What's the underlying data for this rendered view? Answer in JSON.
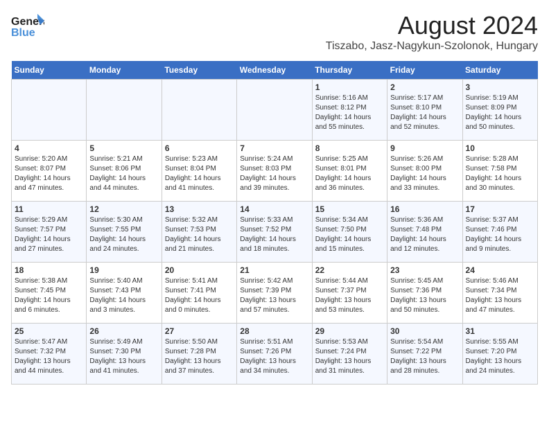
{
  "header": {
    "logo_general": "General",
    "logo_blue": "Blue",
    "title": "August 2024",
    "subtitle": "Tiszabo, Jasz-Nagykun-Szolonok, Hungary"
  },
  "days_of_week": [
    "Sunday",
    "Monday",
    "Tuesday",
    "Wednesday",
    "Thursday",
    "Friday",
    "Saturday"
  ],
  "weeks": [
    [
      {
        "day": "",
        "info": ""
      },
      {
        "day": "",
        "info": ""
      },
      {
        "day": "",
        "info": ""
      },
      {
        "day": "",
        "info": ""
      },
      {
        "day": "1",
        "info": "Sunrise: 5:16 AM\nSunset: 8:12 PM\nDaylight: 14 hours\nand 55 minutes."
      },
      {
        "day": "2",
        "info": "Sunrise: 5:17 AM\nSunset: 8:10 PM\nDaylight: 14 hours\nand 52 minutes."
      },
      {
        "day": "3",
        "info": "Sunrise: 5:19 AM\nSunset: 8:09 PM\nDaylight: 14 hours\nand 50 minutes."
      }
    ],
    [
      {
        "day": "4",
        "info": "Sunrise: 5:20 AM\nSunset: 8:07 PM\nDaylight: 14 hours\nand 47 minutes."
      },
      {
        "day": "5",
        "info": "Sunrise: 5:21 AM\nSunset: 8:06 PM\nDaylight: 14 hours\nand 44 minutes."
      },
      {
        "day": "6",
        "info": "Sunrise: 5:23 AM\nSunset: 8:04 PM\nDaylight: 14 hours\nand 41 minutes."
      },
      {
        "day": "7",
        "info": "Sunrise: 5:24 AM\nSunset: 8:03 PM\nDaylight: 14 hours\nand 39 minutes."
      },
      {
        "day": "8",
        "info": "Sunrise: 5:25 AM\nSunset: 8:01 PM\nDaylight: 14 hours\nand 36 minutes."
      },
      {
        "day": "9",
        "info": "Sunrise: 5:26 AM\nSunset: 8:00 PM\nDaylight: 14 hours\nand 33 minutes."
      },
      {
        "day": "10",
        "info": "Sunrise: 5:28 AM\nSunset: 7:58 PM\nDaylight: 14 hours\nand 30 minutes."
      }
    ],
    [
      {
        "day": "11",
        "info": "Sunrise: 5:29 AM\nSunset: 7:57 PM\nDaylight: 14 hours\nand 27 minutes."
      },
      {
        "day": "12",
        "info": "Sunrise: 5:30 AM\nSunset: 7:55 PM\nDaylight: 14 hours\nand 24 minutes."
      },
      {
        "day": "13",
        "info": "Sunrise: 5:32 AM\nSunset: 7:53 PM\nDaylight: 14 hours\nand 21 minutes."
      },
      {
        "day": "14",
        "info": "Sunrise: 5:33 AM\nSunset: 7:52 PM\nDaylight: 14 hours\nand 18 minutes."
      },
      {
        "day": "15",
        "info": "Sunrise: 5:34 AM\nSunset: 7:50 PM\nDaylight: 14 hours\nand 15 minutes."
      },
      {
        "day": "16",
        "info": "Sunrise: 5:36 AM\nSunset: 7:48 PM\nDaylight: 14 hours\nand 12 minutes."
      },
      {
        "day": "17",
        "info": "Sunrise: 5:37 AM\nSunset: 7:46 PM\nDaylight: 14 hours\nand 9 minutes."
      }
    ],
    [
      {
        "day": "18",
        "info": "Sunrise: 5:38 AM\nSunset: 7:45 PM\nDaylight: 14 hours\nand 6 minutes."
      },
      {
        "day": "19",
        "info": "Sunrise: 5:40 AM\nSunset: 7:43 PM\nDaylight: 14 hours\nand 3 minutes."
      },
      {
        "day": "20",
        "info": "Sunrise: 5:41 AM\nSunset: 7:41 PM\nDaylight: 14 hours\nand 0 minutes."
      },
      {
        "day": "21",
        "info": "Sunrise: 5:42 AM\nSunset: 7:39 PM\nDaylight: 13 hours\nand 57 minutes."
      },
      {
        "day": "22",
        "info": "Sunrise: 5:44 AM\nSunset: 7:37 PM\nDaylight: 13 hours\nand 53 minutes."
      },
      {
        "day": "23",
        "info": "Sunrise: 5:45 AM\nSunset: 7:36 PM\nDaylight: 13 hours\nand 50 minutes."
      },
      {
        "day": "24",
        "info": "Sunrise: 5:46 AM\nSunset: 7:34 PM\nDaylight: 13 hours\nand 47 minutes."
      }
    ],
    [
      {
        "day": "25",
        "info": "Sunrise: 5:47 AM\nSunset: 7:32 PM\nDaylight: 13 hours\nand 44 minutes."
      },
      {
        "day": "26",
        "info": "Sunrise: 5:49 AM\nSunset: 7:30 PM\nDaylight: 13 hours\nand 41 minutes."
      },
      {
        "day": "27",
        "info": "Sunrise: 5:50 AM\nSunset: 7:28 PM\nDaylight: 13 hours\nand 37 minutes."
      },
      {
        "day": "28",
        "info": "Sunrise: 5:51 AM\nSunset: 7:26 PM\nDaylight: 13 hours\nand 34 minutes."
      },
      {
        "day": "29",
        "info": "Sunrise: 5:53 AM\nSunset: 7:24 PM\nDaylight: 13 hours\nand 31 minutes."
      },
      {
        "day": "30",
        "info": "Sunrise: 5:54 AM\nSunset: 7:22 PM\nDaylight: 13 hours\nand 28 minutes."
      },
      {
        "day": "31",
        "info": "Sunrise: 5:55 AM\nSunset: 7:20 PM\nDaylight: 13 hours\nand 24 minutes."
      }
    ]
  ]
}
